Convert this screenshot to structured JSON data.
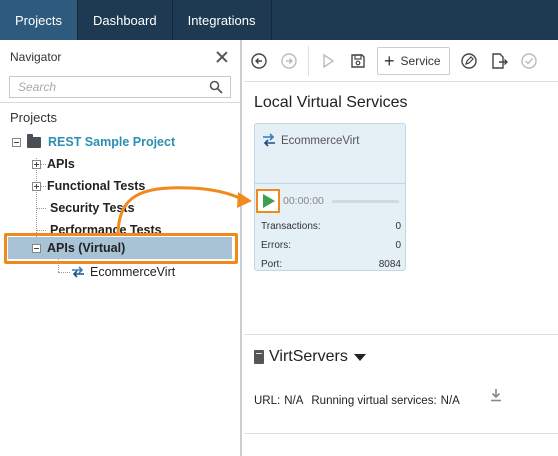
{
  "topnav": {
    "tabs": [
      {
        "label": "Projects",
        "active": true
      },
      {
        "label": "Dashboard",
        "active": false
      },
      {
        "label": "Integrations",
        "active": false
      }
    ]
  },
  "navigator": {
    "title": "Navigator",
    "search_placeholder": "Search",
    "root_label": "Projects",
    "project": "REST Sample Project",
    "items": [
      {
        "label": "APIs",
        "expander": "plus"
      },
      {
        "label": "Functional Tests",
        "expander": "plus"
      },
      {
        "label": "Security Tests",
        "expander": "none"
      },
      {
        "label": "Performance Tests",
        "expander": "none"
      },
      {
        "label": "APIs (Virtual)",
        "expander": "minus",
        "selected": true
      }
    ],
    "virtual_child": "EcommerceVirt"
  },
  "toolbar": {
    "service_label": "Service"
  },
  "main": {
    "title": "Local Virtual Services",
    "card": {
      "name": "EcommerceVirt",
      "timer": "00:00:00",
      "transactions_label": "Transactions:",
      "transactions_value": "0",
      "errors_label": "Errors:",
      "errors_value": "0",
      "port_label": "Port:",
      "port_value": "8084"
    },
    "virtservers": {
      "title": "VirtServers",
      "url_label": "URL:",
      "url_value": "N/A",
      "running_label": "Running virtual services:",
      "running_value": "N/A"
    }
  },
  "colors": {
    "nav_bg": "#1e3a52",
    "nav_active": "#2e5a7e",
    "highlight": "#f08a1c",
    "project_text": "#2a8fb0",
    "selected_row": "#a8c3d6",
    "card_bg": "#e4eff6",
    "play_green": "#3aa24a"
  }
}
